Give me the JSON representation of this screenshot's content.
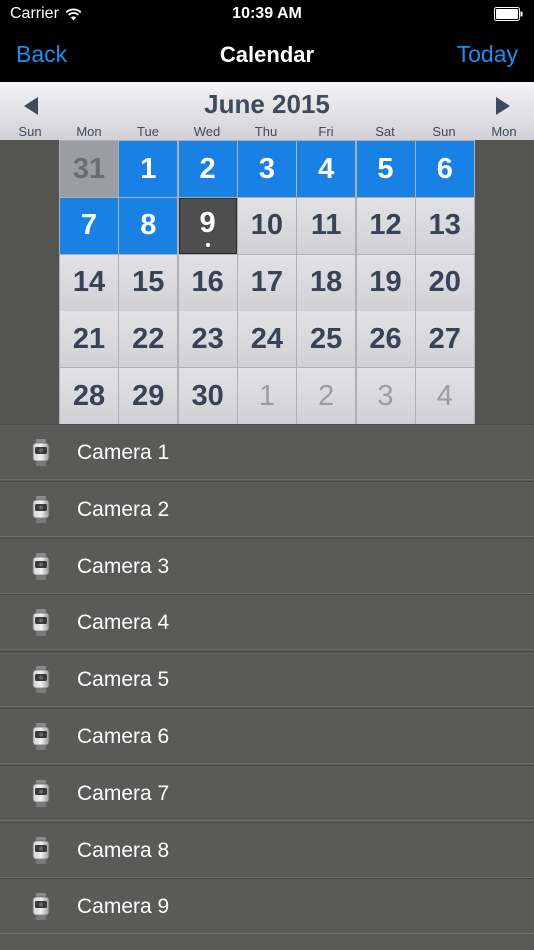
{
  "status_bar": {
    "carrier": "Carrier",
    "time": "10:39 AM"
  },
  "nav": {
    "back": "Back",
    "title": "Calendar",
    "today": "Today"
  },
  "calendar": {
    "month": "June 2015",
    "weekdays": [
      "Sun",
      "Mon",
      "Tue",
      "Wed",
      "Thu",
      "Fri",
      "Sat",
      "Sun",
      "Mon"
    ],
    "weeks": [
      [
        {
          "d": "31",
          "s": "prev"
        },
        {
          "d": "1",
          "s": "sel"
        },
        {
          "d": "2",
          "s": "sel"
        },
        {
          "d": "3",
          "s": "sel"
        },
        {
          "d": "4",
          "s": "sel"
        },
        {
          "d": "5",
          "s": "sel"
        },
        {
          "d": "6",
          "s": "sel"
        }
      ],
      [
        {
          "d": "7",
          "s": "sel"
        },
        {
          "d": "8",
          "s": "sel"
        },
        {
          "d": "9",
          "s": "today"
        },
        {
          "d": "10",
          "s": ""
        },
        {
          "d": "11",
          "s": ""
        },
        {
          "d": "12",
          "s": ""
        },
        {
          "d": "13",
          "s": ""
        }
      ],
      [
        {
          "d": "14",
          "s": ""
        },
        {
          "d": "15",
          "s": ""
        },
        {
          "d": "16",
          "s": ""
        },
        {
          "d": "17",
          "s": ""
        },
        {
          "d": "18",
          "s": ""
        },
        {
          "d": "19",
          "s": ""
        },
        {
          "d": "20",
          "s": ""
        }
      ],
      [
        {
          "d": "21",
          "s": ""
        },
        {
          "d": "22",
          "s": ""
        },
        {
          "d": "23",
          "s": ""
        },
        {
          "d": "24",
          "s": ""
        },
        {
          "d": "25",
          "s": ""
        },
        {
          "d": "26",
          "s": ""
        },
        {
          "d": "27",
          "s": ""
        }
      ],
      [
        {
          "d": "28",
          "s": ""
        },
        {
          "d": "29",
          "s": ""
        },
        {
          "d": "30",
          "s": ""
        },
        {
          "d": "1",
          "s": "adj"
        },
        {
          "d": "2",
          "s": "adj"
        },
        {
          "d": "3",
          "s": "adj"
        },
        {
          "d": "4",
          "s": "adj"
        }
      ]
    ]
  },
  "cameras": [
    "Camera 1",
    "Camera 2",
    "Camera 3",
    "Camera 4",
    "Camera 5",
    "Camera 6",
    "Camera 7",
    "Camera 8",
    "Camera 9"
  ],
  "colors": {
    "accent": "#1c8ff0",
    "selected": "#1a81e4",
    "list_bg": "#5a5b59"
  },
  "icons": {
    "wifi": "wifi-icon",
    "battery": "battery-icon",
    "prev": "left-arrow-icon",
    "next": "right-arrow-icon",
    "camera": "camera-icon"
  }
}
